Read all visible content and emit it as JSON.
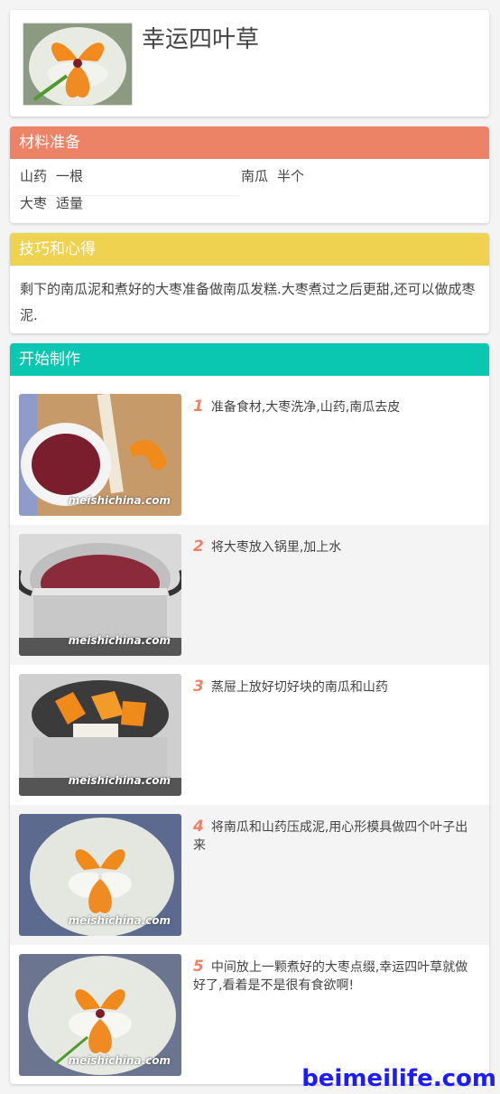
{
  "recipe": {
    "title": "幸运四叶草"
  },
  "ingredients": {
    "heading": "材料准备",
    "items": [
      {
        "name": "山药",
        "amount": "一根"
      },
      {
        "name": "南瓜",
        "amount": "半个"
      },
      {
        "name": "大枣",
        "amount": "适量"
      }
    ]
  },
  "tips": {
    "heading": "技巧和心得",
    "text": "剩下的南瓜泥和煮好的大枣准备做南瓜发糕.大枣煮过之后更甜,还可以做成枣泥."
  },
  "steps": {
    "heading": "开始制作",
    "watermark": "meishichina.com",
    "items": [
      {
        "num": "1",
        "text": "准备食材,大枣洗净,山药,南瓜去皮"
      },
      {
        "num": "2",
        "text": "将大枣放入锅里,加上水"
      },
      {
        "num": "3",
        "text": "蒸屉上放好切好块的南瓜和山药"
      },
      {
        "num": "4",
        "text": "将南瓜和山药压成泥,用心形模具做四个叶子出来"
      },
      {
        "num": "5",
        "text": "中间放上一颗煮好的大枣点缀,幸运四叶草就做好了,看着是不是很有食欲啊!"
      }
    ]
  },
  "footer": {
    "brand": "beimeilife.com"
  },
  "colors": {
    "ingredients_header": "#ec8366",
    "tips_header": "#efd24f",
    "steps_header": "#0ac7b1",
    "step_number": "#ec8366",
    "brand": "#1c1cff"
  }
}
